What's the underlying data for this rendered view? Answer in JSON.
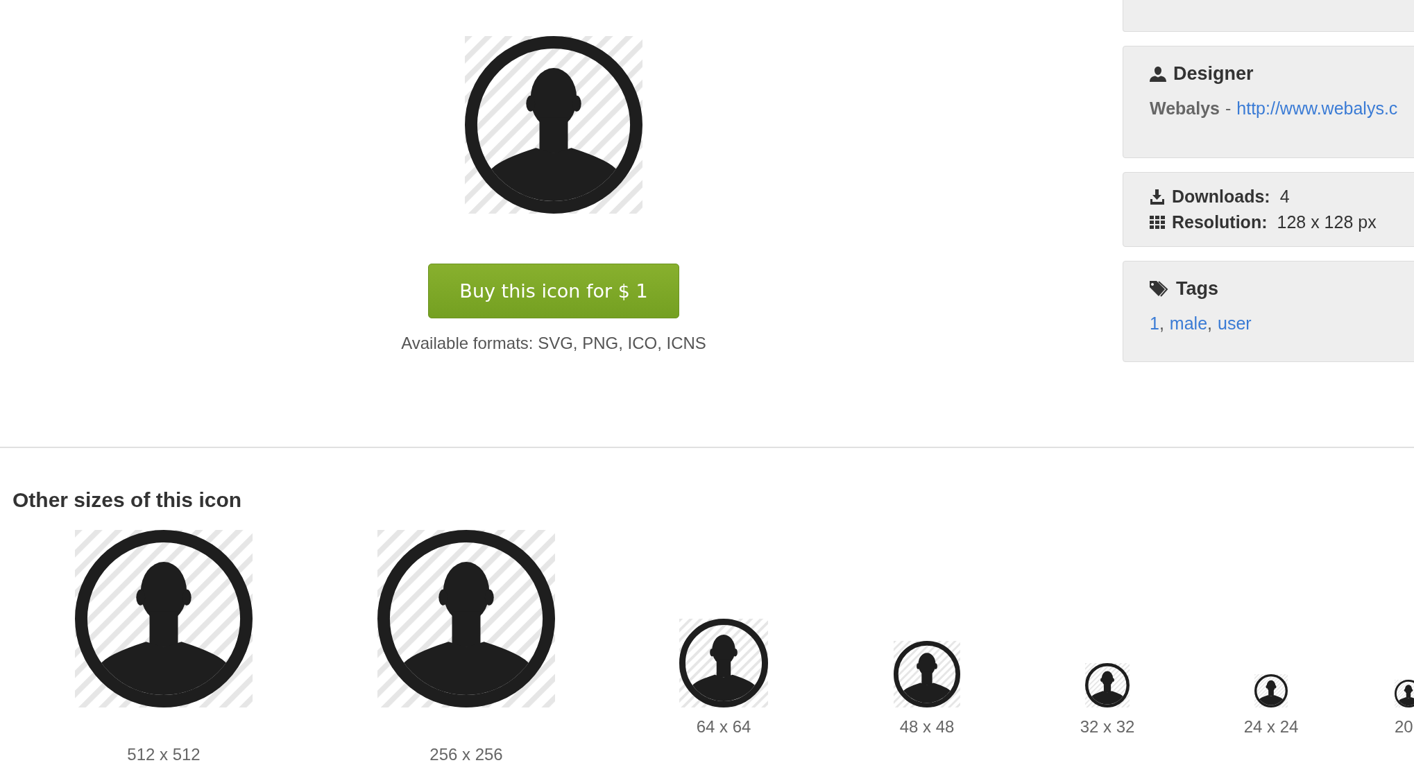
{
  "preview": {
    "buy_button": "Buy this icon for $ 1",
    "formats": "Available formats: SVG, PNG, ICO, ICNS"
  },
  "sidebar": {
    "designer": {
      "title": "Designer",
      "name": "Webalys",
      "separator": "-",
      "link": "http://www.webalys.c"
    },
    "stats": [
      {
        "kind": "downloads",
        "label": "Downloads:",
        "value": "4"
      },
      {
        "kind": "resolution",
        "label": "Resolution:",
        "value": "128 x 128 px"
      }
    ],
    "tags": {
      "title": "Tags",
      "items": [
        "1",
        "male",
        "user"
      ],
      "separator": ","
    }
  },
  "other_sizes": {
    "title": "Other sizes of this icon",
    "sizes": [
      {
        "label": "512 x 512"
      },
      {
        "label": "256 x 256"
      },
      {
        "label": "64 x 64"
      },
      {
        "label": "48 x 48"
      },
      {
        "label": "32 x 32"
      },
      {
        "label": "24 x 24"
      },
      {
        "label": "20"
      }
    ]
  }
}
